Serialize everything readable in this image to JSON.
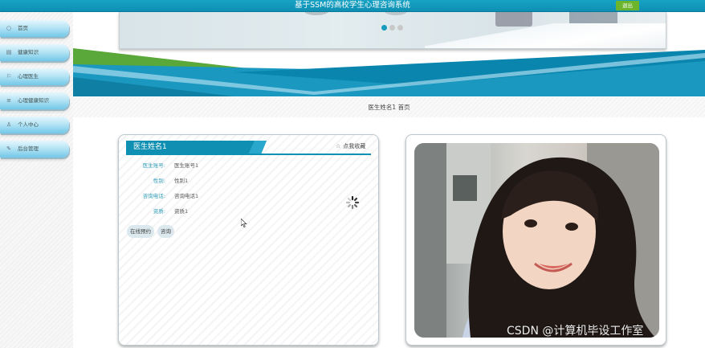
{
  "header": {
    "title": "基于SSM的高校学生心理咨询系统",
    "logout_label": "退出"
  },
  "sidebar": {
    "items": [
      {
        "label": "首页",
        "icon": "home-icon"
      },
      {
        "label": "健康知识",
        "icon": "book-icon"
      },
      {
        "label": "心理医生",
        "icon": "doctor-icon"
      },
      {
        "label": "心理健康知识",
        "icon": "list-icon"
      },
      {
        "label": "个人中心",
        "icon": "user-icon"
      },
      {
        "label": "后台管理",
        "icon": "wrench-icon"
      }
    ]
  },
  "carousel": {
    "active_index": 0,
    "dot_count": 3,
    "active_color": "#1a9bbd",
    "inactive_color": "#c8c8c8"
  },
  "breadcrumb": {
    "current": "医生姓名1",
    "separator": "",
    "home": "首页"
  },
  "detail": {
    "name": "医生姓名1",
    "favorite_label": "点我收藏",
    "fields": [
      {
        "label": "医生账号:",
        "value": "医生账号1"
      },
      {
        "label": "性别:",
        "value": "性别1"
      },
      {
        "label": "咨询电话:",
        "value": "咨询电话1"
      },
      {
        "label": "资质:",
        "value": "资质1"
      }
    ],
    "buttons": {
      "book": "在线预约",
      "consult": "咨询"
    }
  },
  "colors": {
    "accent": "#0f8fb2",
    "logout_green": "#6cb42c",
    "band_green": "#5aa83a"
  },
  "watermark": "CSDN @计算机毕设工作室"
}
